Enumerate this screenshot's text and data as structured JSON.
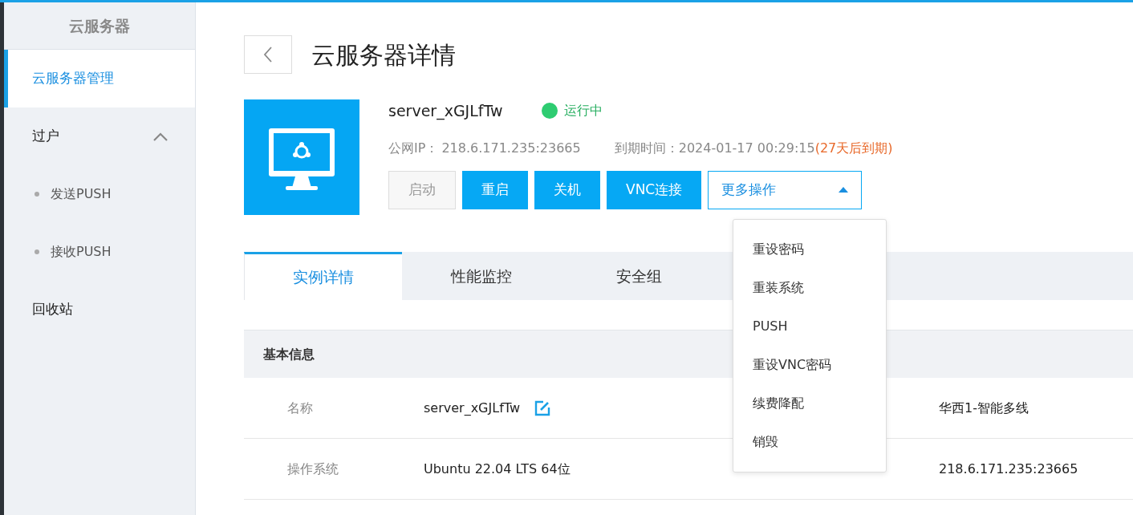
{
  "sidebar": {
    "title": "云服务器",
    "items": [
      {
        "label": "云服务器管理",
        "selected": true
      },
      {
        "label": "过户",
        "selected": false,
        "expanded": true,
        "children": [
          {
            "label": "发送PUSH",
            "selected": false
          },
          {
            "label": "接收PUSH",
            "selected": false
          }
        ]
      },
      {
        "label": "回收站",
        "selected": false
      }
    ]
  },
  "page": {
    "title": "云服务器详情"
  },
  "server": {
    "name": "server_xGJLfTw",
    "status": "运行中",
    "ip_label": "公网IP：",
    "ip": "218.6.171.235:23665",
    "expiry_label": "到期时间：",
    "expiry": "2024-01-17 00:29:15",
    "expiry_note": "(27天后到期)"
  },
  "actions": [
    {
      "label": "启动",
      "disabled": true
    },
    {
      "label": "重启",
      "disabled": false
    },
    {
      "label": "关机",
      "disabled": false
    },
    {
      "label": "VNC连接",
      "disabled": false
    }
  ],
  "more_menu": {
    "label": "更多操作",
    "expanded": true,
    "items": [
      "重设密码",
      "重装系统",
      "PUSH",
      "重设VNC密码",
      "续费降配",
      "销毁"
    ]
  },
  "tabs": [
    {
      "label": "实例详情",
      "selected": true
    },
    {
      "label": "性能监控",
      "selected": false
    },
    {
      "label": "安全组",
      "selected": false
    }
  ],
  "section": {
    "title": "基本信息",
    "rows": [
      {
        "label": "名称",
        "value": "server_xGJLfTw",
        "editable": true,
        "value_2": "华西1-智能多线"
      },
      {
        "label": "操作系统",
        "value": "Ubuntu 22.04 LTS 64位",
        "editable": false,
        "value_2": "218.6.171.235:23665"
      }
    ]
  }
}
